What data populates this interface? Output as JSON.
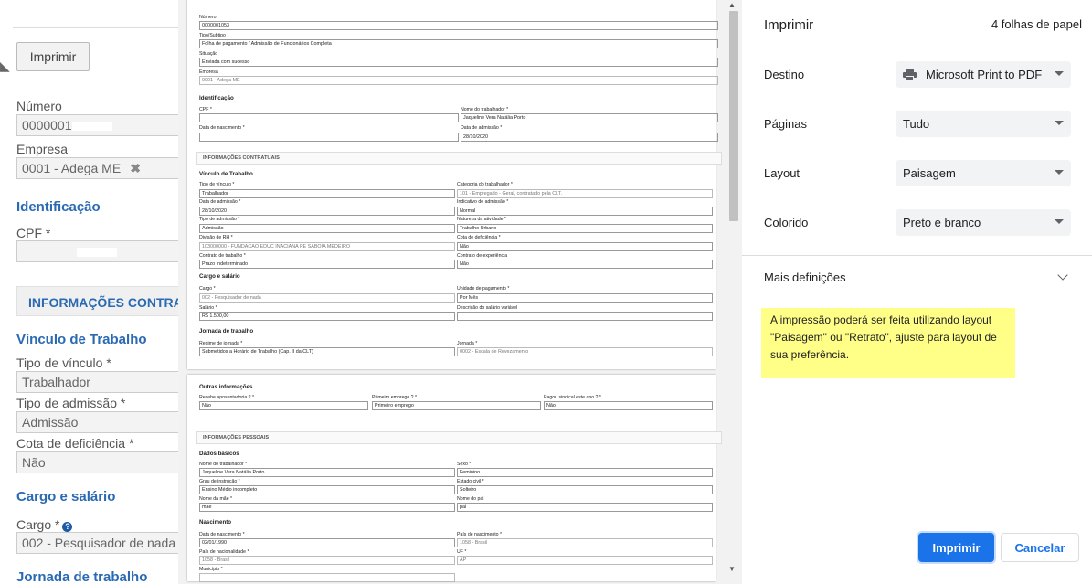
{
  "background_form": {
    "print_button": "Imprimir",
    "numero_label": "Número",
    "numero_value": "0000001",
    "empresa_label": "Empresa",
    "empresa_value": "0001 - Adega ME",
    "identificacao": "Identificação",
    "cpf_label": "CPF *",
    "band": "INFORMAÇÕES CONTRA",
    "vinculo": "Vínculo de Trabalho",
    "tipo_vinculo_label": "Tipo de vínculo *",
    "tipo_vinculo_value": "Trabalhador",
    "tipo_admissao_label": "Tipo de admissão *",
    "tipo_admissao_value": "Admissão",
    "cota_label": "Cota de deficiência *",
    "cota_value": "Não",
    "cargo_section": "Cargo e salário",
    "cargo_label": "Cargo *",
    "cargo_value": "002 - Pesquisador de nada",
    "jornada_section": "Jornada de trabalho"
  },
  "preview": {
    "page1": {
      "numero_label": "Número",
      "numero_value": "0000001053",
      "tipo_label": "Tipo/Subtipo",
      "tipo_value": "Folha de pagamento / Admissão de Funcionários Completa",
      "situacao_label": "Situação",
      "situacao_value": "Enviada com sucesso",
      "empresa_label": "Empresa",
      "empresa_value": "0001 - Adega ME",
      "identificacao": "Identificação",
      "cpf_label": "CPF *",
      "nome_trab_label": "Nome do trabalhador *",
      "nome_trab_value": "Jaqueline Vera Natália Porto",
      "data_nasc_label": "Data de nascimento *",
      "data_adm_label": "Data de admissão *",
      "data_adm_value": "28/10/2020",
      "band_contratuais": "INFORMAÇÕES CONTRATUAIS",
      "vinculo": "Vínculo de Trabalho",
      "tipo_vinculo_label": "Tipo de vínculo *",
      "tipo_vinculo_value": "Trabalhador",
      "categoria_label": "Categoria do trabalhador *",
      "categoria_value": "101 - Empregado - Geral, contratado pela CLT.",
      "data_adm2_label": "Data de admissão *",
      "data_adm2_value": "28/10/2020",
      "indicativo_label": "Indicativo de admissão *",
      "indicativo_value": "Normal",
      "tipo_adm_label": "Tipo de admissão *",
      "tipo_adm_value": "Admissão",
      "natureza_label": "Natureza da atividade *",
      "natureza_value": "Trabalho Urbano",
      "divisao_label": "Divisão de RH *",
      "divisao_value": "103000000 - FUNDACAO EDUC INACIANA PE SABOIA MEDEIRO",
      "cota_label": "Cota de deficiência *",
      "cota_value": "Não",
      "contrato_label": "Contrato de trabalho *",
      "contrato_value": "Prazo Indeterminado",
      "experiencia_label": "Contrato de experiência",
      "experiencia_value": "Não",
      "cargo_section": "Cargo e salário",
      "cargo_label": "Cargo *",
      "cargo_value": "002 - Pesquisador de nada",
      "unidade_label": "Unidade de pagamento *",
      "unidade_value": "Por Mês",
      "salario_label": "Salário *",
      "salario_value": "R$ 1.500,00",
      "desc_salario_label": "Descrição do salário variável",
      "jornada_section": "Jornada de trabalho",
      "regime_label": "Regime de jornada *",
      "regime_value": "Submetidos a Horário de Trabalho (Cap. II da CLT)",
      "jornada_label": "Jornada *",
      "jornada_value": "0002 - Escala de Revezamento"
    },
    "page2": {
      "outras": "Outras informações",
      "aposentadoria_label": "Recebe aposentadoria ? *",
      "aposentadoria_value": "Não",
      "primeiro_label": "Primeiro emprego ? *",
      "primeiro_value": "Primeiro emprego",
      "sindical_label": "Pagou sindical este ano ? *",
      "sindical_value": "Não",
      "band_pessoais": "INFORMAÇÕES PESSOAIS",
      "dados": "Dados básicos",
      "nome_label": "Nome do trabalhador *",
      "nome_value": "Jaqueline Vera Natália Porto",
      "sexo_label": "Sexo *",
      "sexo_value": "Feminino",
      "grau_label": "Grau de instrução *",
      "grau_value": "Ensino Médio incompleto",
      "estado_label": "Estado civil *",
      "estado_value": "Solteiro",
      "mae_label": "Nome da mãe *",
      "mae_value": "mae",
      "pai_label": "Nome do pai",
      "pai_value": "pai",
      "nascimento": "Nascimento",
      "data_nasc_label": "Data de nascimento *",
      "data_nasc_value": "02/01/1990",
      "pais_nasc_label": "País de nascimento *",
      "pais_nasc_value": "1058 - Brasil",
      "pais_nac_label": "País de nacionalidade *",
      "pais_nac_value": "1058 - Brasil",
      "uf_label": "UF *",
      "uf_value": "AP",
      "municipio_label": "Município *"
    }
  },
  "settings": {
    "title": "Imprimir",
    "sheets": "4 folhas de papel",
    "destino_label": "Destino",
    "destino_value": "Microsoft Print to PDF",
    "paginas_label": "Páginas",
    "paginas_value": "Tudo",
    "layout_label": "Layout",
    "layout_value": "Paisagem",
    "colorido_label": "Colorido",
    "colorido_value": "Preto e branco",
    "more": "Mais definições",
    "note": "A impressão poderá ser feita utilizando layout \"Paisagem\" ou \"Retrato\", ajuste para layout de sua preferência.",
    "print_button": "Imprimir",
    "cancel_button": "Cancelar"
  }
}
